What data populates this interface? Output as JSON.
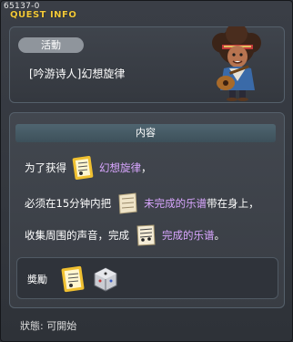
{
  "window": {
    "quest_id": "65137-0",
    "title": "QUEST INFO"
  },
  "header": {
    "activity_label": "活動",
    "quest_name": "[吟游诗人]幻想旋律",
    "npc_icon": "bard-npc-portrait"
  },
  "content": {
    "section_title": "内容",
    "line1": {
      "prefix": "为了获得",
      "icon": "music-scroll-gold-icon",
      "highlight": "幻想旋律",
      "suffix": "，"
    },
    "line2": {
      "prefix": "必须在15分钟内把",
      "icon": "unfinished-sheet-music-icon",
      "highlight": "未完成的乐谱",
      "suffix": "带在身上，"
    },
    "line3": {
      "prefix": "收集周围的声音，完成",
      "icon": "finished-sheet-music-icon",
      "highlight": "完成的乐谱",
      "suffix": "。"
    },
    "highlight_color": "#d9a6ff"
  },
  "reward": {
    "label": "奬勵",
    "items": [
      {
        "icon": "music-scroll-gold-icon"
      },
      {
        "icon": "damage-skin-box-icon"
      }
    ]
  },
  "status": {
    "text": "狀態:   可開始"
  }
}
